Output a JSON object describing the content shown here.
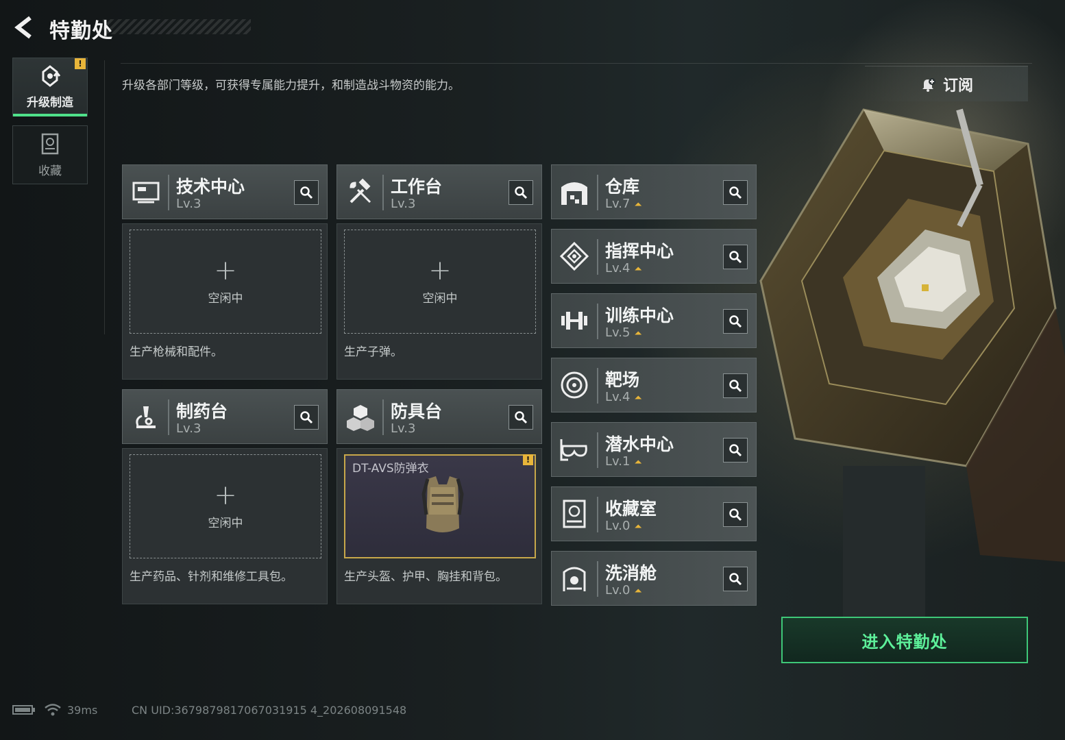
{
  "header": {
    "title": "特勤处"
  },
  "subtitle": "升级各部门等级，可获得专属能力提升，和制造战斗物资的能力。",
  "subscribe": {
    "label": "订阅"
  },
  "sidebar": {
    "tabs": [
      {
        "label": "升级制造",
        "badge": "!"
      },
      {
        "label": "收藏"
      }
    ]
  },
  "production_cards": [
    {
      "name": "技术中心",
      "level": "Lv.3",
      "slot": {
        "plus": "+",
        "status": "空闲中"
      },
      "desc": "生产枪械和配件。"
    },
    {
      "name": "工作台",
      "level": "Lv.3",
      "slot": {
        "plus": "+",
        "status": "空闲中"
      },
      "desc": "生产子弹。"
    },
    {
      "name": "制药台",
      "level": "Lv.3",
      "slot": {
        "plus": "+",
        "status": "空闲中"
      },
      "desc": "生产药品、针剂和维修工具包。"
    },
    {
      "name": "防具台",
      "level": "Lv.3",
      "item": {
        "name": "DT-AVS防弹衣",
        "badge": "!"
      },
      "desc": "生产头盔、护甲、胸挂和背包。"
    }
  ],
  "facilities": [
    {
      "name": "仓库",
      "level": "Lv.7"
    },
    {
      "name": "指挥中心",
      "level": "Lv.4"
    },
    {
      "name": "训练中心",
      "level": "Lv.5"
    },
    {
      "name": "靶场",
      "level": "Lv.4"
    },
    {
      "name": "潜水中心",
      "level": "Lv.1"
    },
    {
      "name": "收藏室",
      "level": "Lv.0"
    },
    {
      "name": "洗消舱",
      "level": "Lv.0"
    }
  ],
  "enter_button": {
    "label": "进入特勤处"
  },
  "status_bar": {
    "ping": "39ms",
    "uid": "CN UID:3679879817067031915 4_202608091548"
  },
  "colors": {
    "accent_green": "#4fe18a",
    "badge_yellow": "#e8b53a",
    "item_border": "#c8a84a"
  }
}
